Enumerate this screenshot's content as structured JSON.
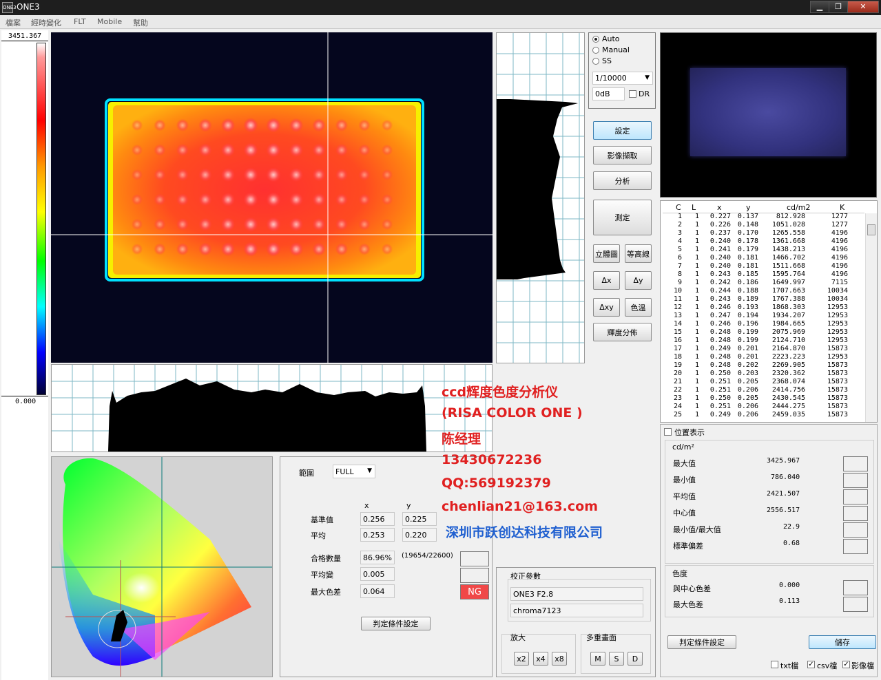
{
  "window": {
    "title": "ONE3",
    "icon_text": "ONE3",
    "minimize": "▁",
    "restore": "❐",
    "close": "✕"
  },
  "menu": [
    "檔案",
    "經時變化",
    "FLT",
    "Mobile",
    "幫助"
  ],
  "scale": {
    "max": "3451.367",
    "min": "0.000"
  },
  "exposure": {
    "modes": [
      {
        "label": "Auto",
        "selected": true
      },
      {
        "label": "Manual",
        "selected": false
      },
      {
        "label": "SS",
        "selected": false
      }
    ],
    "shutter": "1/10000",
    "gain": "0dB",
    "dr_label": "DR"
  },
  "buttons": {
    "settings": "設定",
    "capture": "影像擷取",
    "analyze": "分析",
    "measure": "測定",
    "stereo": "立體圖",
    "contour": "等高線",
    "dx": "Δx",
    "dy": "Δy",
    "dxy": "Δxy",
    "color_temp": "色溫",
    "lum_dist": "輝度分佈"
  },
  "table": {
    "headers": [
      "C",
      "L",
      "x",
      "y",
      "cd/m2",
      "K"
    ],
    "rows": [
      [
        "1",
        "1",
        "0.227",
        "0.137",
        "812.928",
        "1277"
      ],
      [
        "2",
        "1",
        "0.226",
        "0.148",
        "1051.028",
        "1277"
      ],
      [
        "3",
        "1",
        "0.237",
        "0.170",
        "1265.558",
        "4196"
      ],
      [
        "4",
        "1",
        "0.240",
        "0.178",
        "1361.668",
        "4196"
      ],
      [
        "5",
        "1",
        "0.241",
        "0.179",
        "1438.213",
        "4196"
      ],
      [
        "6",
        "1",
        "0.240",
        "0.181",
        "1466.702",
        "4196"
      ],
      [
        "7",
        "1",
        "0.240",
        "0.181",
        "1511.668",
        "4196"
      ],
      [
        "8",
        "1",
        "0.243",
        "0.185",
        "1595.764",
        "4196"
      ],
      [
        "9",
        "1",
        "0.242",
        "0.186",
        "1649.997",
        "7115"
      ],
      [
        "10",
        "1",
        "0.244",
        "0.188",
        "1707.663",
        "10034"
      ],
      [
        "11",
        "1",
        "0.243",
        "0.189",
        "1767.388",
        "10034"
      ],
      [
        "12",
        "1",
        "0.246",
        "0.193",
        "1868.303",
        "12953"
      ],
      [
        "13",
        "1",
        "0.247",
        "0.194",
        "1934.207",
        "12953"
      ],
      [
        "14",
        "1",
        "0.246",
        "0.196",
        "1984.665",
        "12953"
      ],
      [
        "15",
        "1",
        "0.248",
        "0.199",
        "2075.969",
        "12953"
      ],
      [
        "16",
        "1",
        "0.248",
        "0.199",
        "2124.710",
        "12953"
      ],
      [
        "17",
        "1",
        "0.249",
        "0.201",
        "2164.870",
        "15873"
      ],
      [
        "18",
        "1",
        "0.248",
        "0.201",
        "2223.223",
        "12953"
      ],
      [
        "19",
        "1",
        "0.248",
        "0.202",
        "2269.905",
        "15873"
      ],
      [
        "20",
        "1",
        "0.250",
        "0.203",
        "2320.362",
        "15873"
      ],
      [
        "21",
        "1",
        "0.251",
        "0.205",
        "2368.074",
        "15873"
      ],
      [
        "22",
        "1",
        "0.251",
        "0.206",
        "2414.756",
        "15873"
      ],
      [
        "23",
        "1",
        "0.250",
        "0.205",
        "2430.545",
        "15873"
      ],
      [
        "24",
        "1",
        "0.251",
        "0.206",
        "2444.275",
        "15873"
      ],
      [
        "25",
        "1",
        "0.249",
        "0.206",
        "2459.035",
        "15873"
      ]
    ]
  },
  "stats": {
    "position_display": "位置表示",
    "unit": "cd/m²",
    "rows": [
      {
        "label": "最大值",
        "value": "3425.967"
      },
      {
        "label": "最小值",
        "value": "786.040"
      },
      {
        "label": "平均值",
        "value": "2421.507"
      },
      {
        "label": "中心值",
        "value": "2556.517"
      },
      {
        "label": "最小值/最大值",
        "value": "22.9"
      },
      {
        "label": "標準偏差",
        "value": "0.68"
      }
    ],
    "color_title": "色度",
    "color_rows": [
      {
        "label": "與中心色差",
        "value": "0.000"
      },
      {
        "label": "最大色差",
        "value": "0.113"
      }
    ],
    "judge_settings": "判定條件設定",
    "save": "儲存",
    "exports": [
      {
        "label": "txt檔",
        "checked": false
      },
      {
        "label": "csv檔",
        "checked": true
      },
      {
        "label": "影像檔",
        "checked": true
      }
    ]
  },
  "evaluation": {
    "range_label": "範圍",
    "range_value": "FULL",
    "col_x": "x",
    "col_y": "y",
    "reference_label": "基準值",
    "reference_x": "0.256",
    "reference_y": "0.225",
    "average_label": "平均",
    "average_x": "0.253",
    "average_y": "0.220",
    "pass_label": "合格數量",
    "pass_value": "86.96%",
    "pass_count": "(19654/22600)",
    "avg_change_label": "平均變",
    "avg_change_value": "0.005",
    "max_diff_label": "最大色差",
    "max_diff_value": "0.064",
    "result": "NG",
    "judge_button": "判定條件設定"
  },
  "calibration": {
    "title": "校正參數",
    "param1": "ONE3 F2.8",
    "param2": "chroma7123",
    "zoom_label": "放大",
    "zoom_buttons": [
      "x2",
      "x4",
      "x8"
    ],
    "multi_label": "多重畫面",
    "multi_buttons": [
      "M",
      "S",
      "D"
    ]
  },
  "overlay": [
    "ccd辉度色度分析仪",
    "(RISA COLOR ONE   )",
    "陈经理",
    "13430672236",
    "QQ:569192379",
    "chenlian21@163.com",
    "深圳市跃创达科技有限公司"
  ],
  "colors": {
    "accent": "#3c7fb1",
    "ng": "#f04040",
    "overlay_text": "#e02020"
  }
}
